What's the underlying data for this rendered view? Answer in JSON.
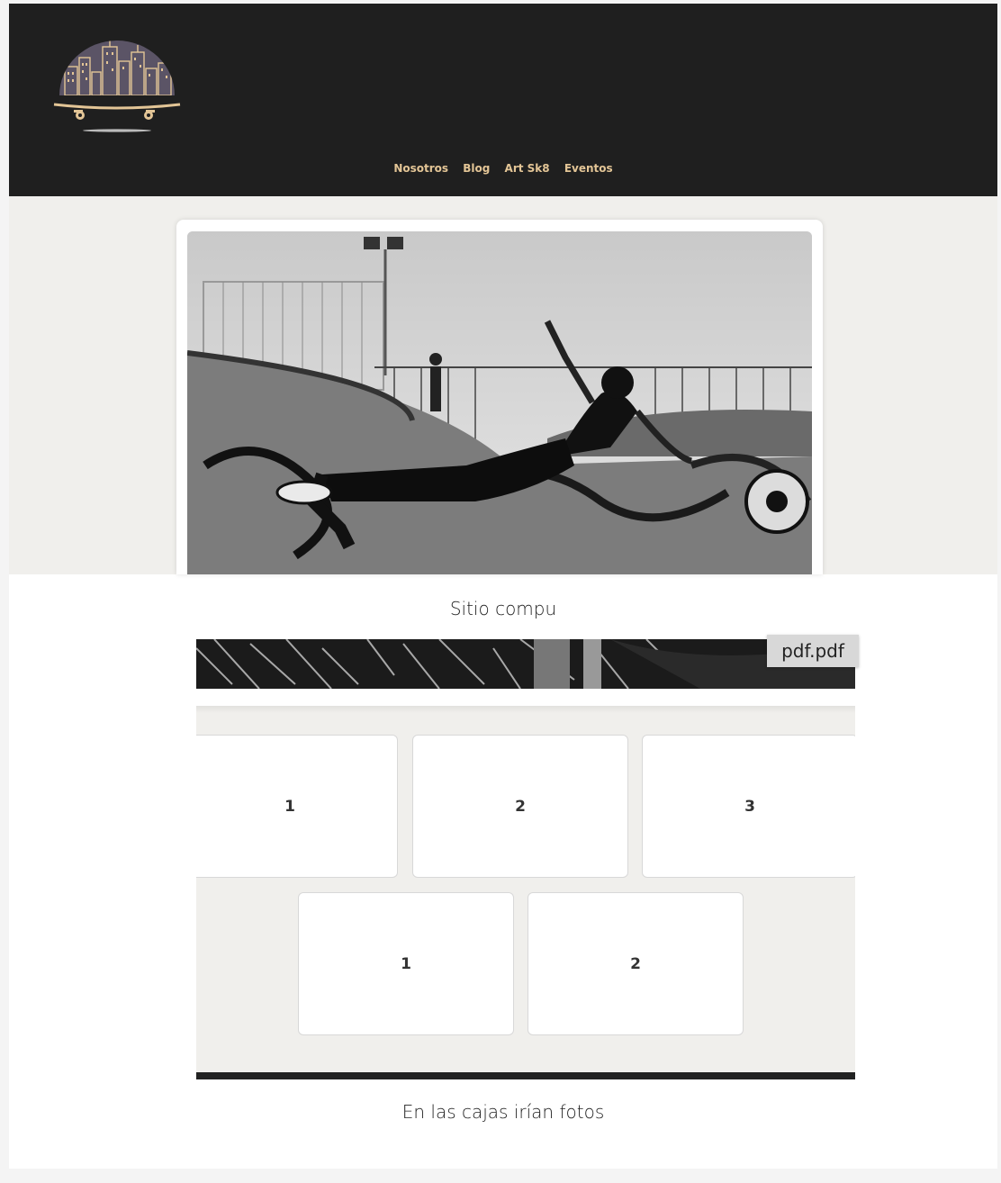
{
  "header": {
    "logo_icon": "skate-city-logo-icon",
    "nav": [
      "Nosotros",
      "Blog",
      "Art Sk8",
      "Eventos"
    ],
    "background": "#1f1f1f",
    "nav_color": "#e3c596"
  },
  "hero": {
    "photo": "skater-in-bowl-photo"
  },
  "captions": {
    "site": "Sitio compu",
    "gallery": "En las cajas irían fotos"
  },
  "pdf_button": "pdf.pdf",
  "gallery": {
    "row1": [
      "1",
      "2",
      "3"
    ],
    "row2": [
      "1",
      "2"
    ]
  }
}
